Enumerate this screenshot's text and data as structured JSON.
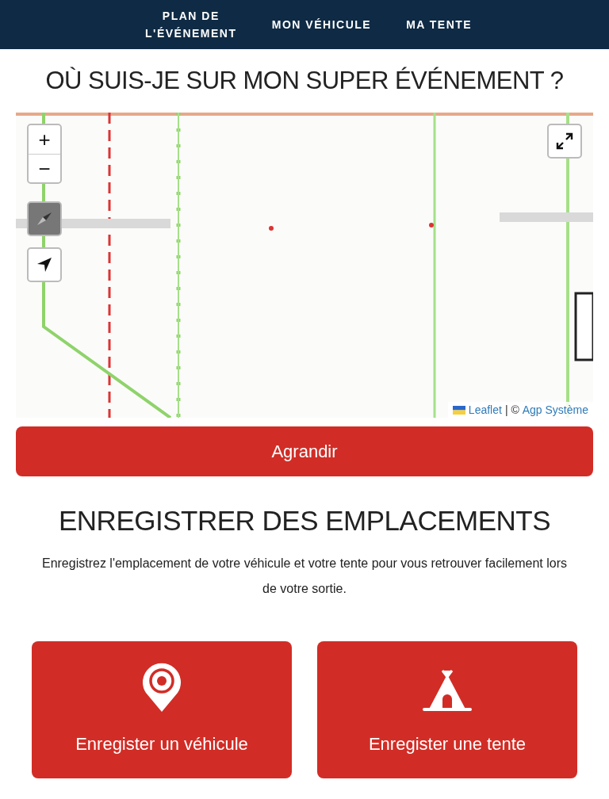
{
  "nav": [
    {
      "label": "PLAN DE L'ÉVÉNEMENT"
    },
    {
      "label": "MON VÉHICULE"
    },
    {
      "label": "MA TENTE"
    }
  ],
  "title": "OÙ SUIS-JE SUR MON SUPER ÉVÉNEMENT ?",
  "map": {
    "zoom_in": "+",
    "zoom_out": "−",
    "attribution": {
      "link": "Leaflet",
      "separator": "| ©",
      "credit": "Agp Système"
    }
  },
  "expand_button": "Agrandir",
  "section": {
    "heading": "ENREGISTRER DES EMPLACEMENTS",
    "text": "Enregistrez l'emplacement de votre véhicule et votre tente pour vous retrouver facilement lors de votre sortie."
  },
  "cards": [
    {
      "kind": "vehicle",
      "label": "Enregister un véhicule"
    },
    {
      "kind": "tent",
      "label": "Enregister une tente"
    }
  ]
}
